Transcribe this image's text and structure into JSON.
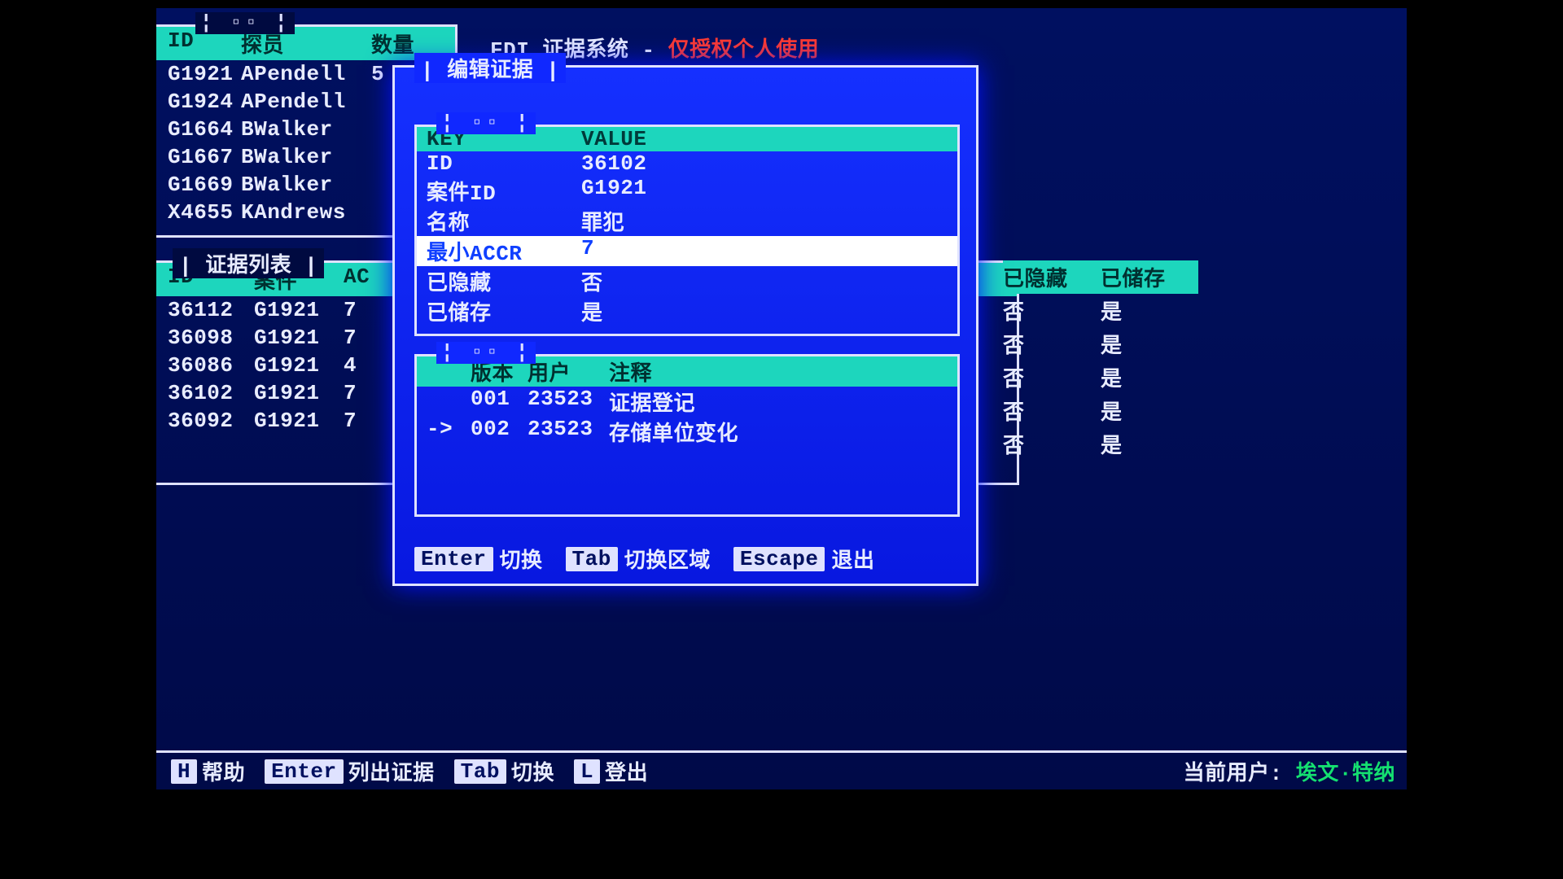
{
  "header": {
    "system": "FDI 证据系统 -",
    "warning": "仅授权个人使用"
  },
  "agents": {
    "headers": {
      "id": "ID",
      "agent": "探员",
      "count": "数量"
    },
    "rows": [
      {
        "id": "G1921",
        "agent": "APendell",
        "count": "5"
      },
      {
        "id": "G1924",
        "agent": "APendell",
        "count": ""
      },
      {
        "id": "G1664",
        "agent": "BWalker",
        "count": ""
      },
      {
        "id": "G1667",
        "agent": "BWalker",
        "count": ""
      },
      {
        "id": "G1669",
        "agent": "BWalker",
        "count": ""
      },
      {
        "id": "X4655",
        "agent": "KAndrews",
        "count": ""
      }
    ]
  },
  "evlist": {
    "title": "| 证据列表 |",
    "headers": {
      "id": "ID",
      "case": "案件",
      "ac": "AC"
    },
    "rows": [
      {
        "id": "36112",
        "case": "G1921",
        "ac": "7"
      },
      {
        "id": "36098",
        "case": "G1921",
        "ac": "7"
      },
      {
        "id": "36086",
        "case": "G1921",
        "ac": "4"
      },
      {
        "id": "36102",
        "case": "G1921",
        "ac": "7"
      },
      {
        "id": "36092",
        "case": "G1921",
        "ac": "7"
      }
    ]
  },
  "rightstrip": {
    "headers": {
      "hidden": "已隐藏",
      "stored": "已储存"
    },
    "rows": [
      {
        "hidden": "否",
        "stored": "是"
      },
      {
        "hidden": "否",
        "stored": "是"
      },
      {
        "hidden": "否",
        "stored": "是"
      },
      {
        "hidden": "否",
        "stored": "是"
      },
      {
        "hidden": "否",
        "stored": "是"
      }
    ]
  },
  "modal": {
    "title": "| 编辑证据 |",
    "kv": {
      "headers": {
        "key": "KEY",
        "value": "VALUE"
      },
      "rows": [
        {
          "k": "ID",
          "v": "36102",
          "hl": false
        },
        {
          "k": "案件ID",
          "v": "G1921",
          "hl": false
        },
        {
          "k": "名称",
          "v": "罪犯",
          "hl": false
        },
        {
          "k": "最小ACCR",
          "v": "7",
          "hl": true
        },
        {
          "k": "已隐藏",
          "v": "否",
          "hl": false
        },
        {
          "k": "已储存",
          "v": "是",
          "hl": false
        }
      ]
    },
    "log": {
      "headers": {
        "ver": "版本",
        "user": "用户",
        "note": "注释"
      },
      "rows": [
        {
          "arrow": "",
          "ver": "001",
          "user": "23523",
          "note": "证据登记"
        },
        {
          "arrow": "->",
          "ver": "002",
          "user": "23523",
          "note": "存储单位变化"
        }
      ]
    },
    "help": {
      "enter_key": "Enter",
      "enter_label": "切换",
      "tab_key": "Tab",
      "tab_label": "切换区域",
      "esc_key": "Escape",
      "esc_label": "退出"
    }
  },
  "helpbar": {
    "h_key": "H",
    "h_label": "帮助",
    "enter_key": "Enter",
    "enter_label": "列出证据",
    "tab_key": "Tab",
    "tab_label": "切换",
    "l_key": "L",
    "l_label": "登出",
    "user_label": "当前用户:",
    "user_value": "埃文·特纳"
  },
  "deco": {
    "notch": "¦ ▫▫ ¦"
  }
}
